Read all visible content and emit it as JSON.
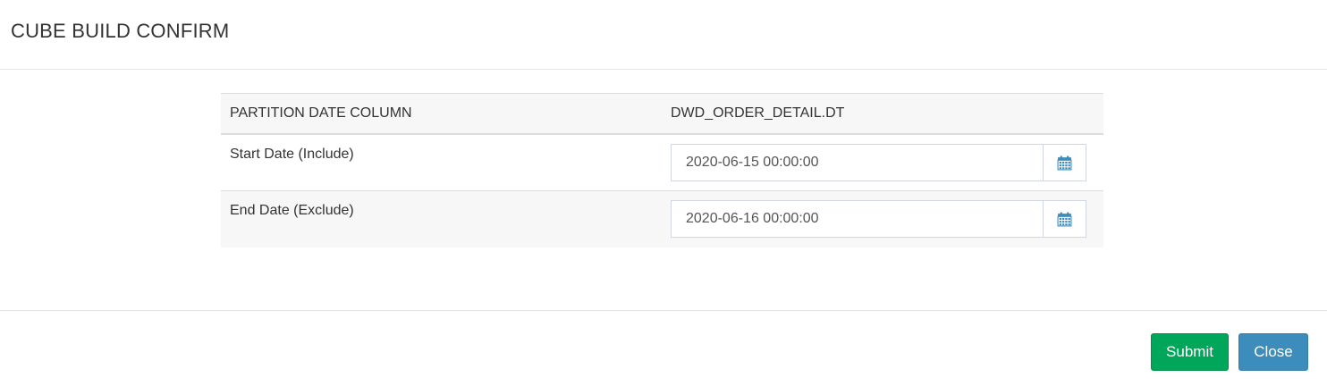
{
  "modal": {
    "title": "CUBE BUILD CONFIRM"
  },
  "table": {
    "header": {
      "label": "PARTITION DATE COLUMN",
      "value": "DWD_ORDER_DETAIL.DT"
    },
    "start": {
      "label": "Start Date (Include)",
      "value": "2020-06-15 00:00:00",
      "icon": "calendar-icon"
    },
    "end": {
      "label": "End Date (Exclude)",
      "value": "2020-06-16 00:00:00",
      "icon": "calendar-icon"
    }
  },
  "footer": {
    "submit_label": "Submit",
    "close_label": "Close"
  },
  "colors": {
    "submit": "#00a65a",
    "close": "#3c8dbc",
    "calendar_icon": "#3c8dbc"
  }
}
